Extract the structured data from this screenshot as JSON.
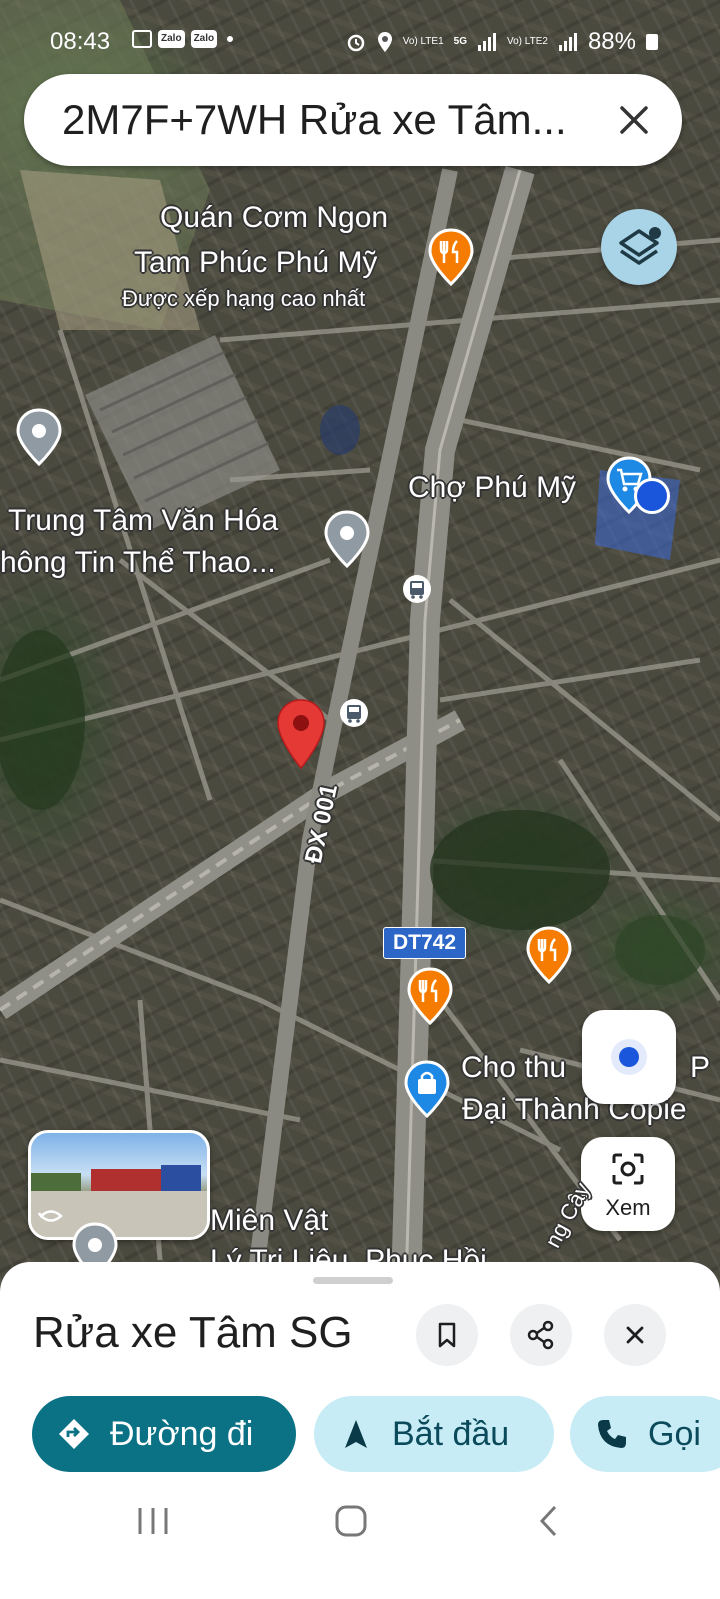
{
  "status_bar": {
    "time": "08:43",
    "app_badges": [
      "Zalo",
      "Zalo"
    ],
    "sim1": "Vo) LTE1",
    "sim2": "Vo) LTE2",
    "network": "5G",
    "battery": "88%"
  },
  "search": {
    "query": "2M7F+7WH Rửa xe Tâm..."
  },
  "map": {
    "labels": {
      "restaurant_line1": "Quán Cơm Ngon",
      "restaurant_line2": "Tam Phúc Phú Mỹ",
      "restaurant_badge": "Được xếp hạng cao nhất",
      "market": "Chợ Phú Mỹ",
      "culture_line1": "Trung Tâm Văn Hóa",
      "culture_line2": "hông Tin Thể Thao...",
      "road_dx": "ĐX 001",
      "road_dt": "DT742",
      "rental_line1": "Cho thu",
      "rental_line1_end": "P",
      "rental_line2": "Đại Thành Copie",
      "bottom_line1": "Miên Vật",
      "bottom_line2": "Lý Trị Liệu, Phục Hồi",
      "street_partial": "ng Cây"
    },
    "xem_label": "Xem",
    "icons": [
      "layers-icon",
      "my-location-icon",
      "lens-icon",
      "restaurant-icon",
      "bus-stop-icon",
      "shopping-icon",
      "place-pin-icon"
    ]
  },
  "sheet": {
    "title": "Rửa xe Tâm SG",
    "actions": {
      "directions": "Đường đi",
      "start": "Bắt đầu",
      "call": "Gọi"
    }
  },
  "colors": {
    "primary_button": "#0b7285",
    "secondary_button": "#c8ecf6",
    "pin_red": "#e53935",
    "restaurant_orange": "#f57c00",
    "location_blue": "#1a56db"
  }
}
